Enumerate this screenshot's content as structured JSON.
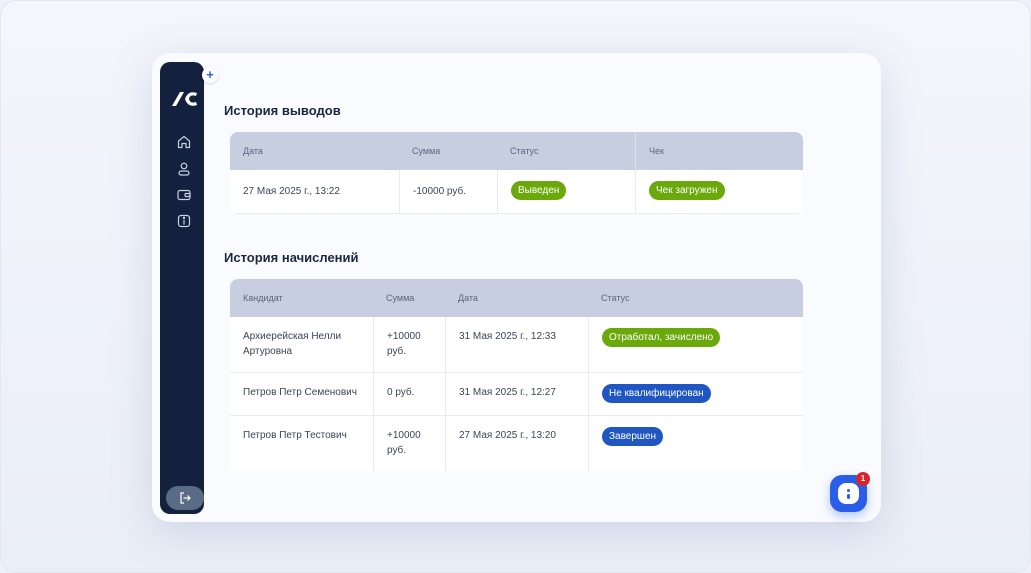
{
  "app": {
    "logo_text": "IC"
  },
  "sidebar": {
    "expand_label": "+",
    "items": [
      {
        "icon": "home-icon"
      },
      {
        "icon": "user-icon"
      },
      {
        "icon": "wallet-icon"
      },
      {
        "icon": "info-icon"
      }
    ],
    "logout_icon": "logout-icon"
  },
  "withdrawals": {
    "title": "История выводов",
    "columns": [
      "Дата",
      "Сумма",
      "Статус",
      "Чек"
    ],
    "rows": [
      {
        "date": "27 Мая 2025 г., 13:22",
        "amount": "-10000 руб.",
        "status": "Выведен",
        "receipt": "Чек загружен"
      }
    ]
  },
  "accruals": {
    "title": "История начислений",
    "columns": [
      "Кандидат",
      "Сумма",
      "Дата",
      "Статус"
    ],
    "rows": [
      {
        "candidate": "Архиерейская Нелли Артуровна",
        "amount": "+10000 руб.",
        "date": "31 Мая 2025 г., 12:33",
        "status": "Отработал, зачислено"
      },
      {
        "candidate": "Петров Петр Семенович",
        "amount": "0 руб.",
        "date": "31 Мая 2025 г., 12:27",
        "status": "Не квалифицирован"
      },
      {
        "candidate": "Петров Петр Тестович",
        "amount": "+10000 руб.",
        "date": "27 Мая 2025 г., 13:20",
        "status": "Завершен"
      }
    ]
  },
  "chat": {
    "unread_count": "1"
  },
  "colors": {
    "sidebar": "#13213e",
    "header_bg": "#c7cedf",
    "badge_green": "#6aa80c",
    "badge_blue": "#1f56c2",
    "chat_blue": "#2a5ee8",
    "notify_red": "#d9242a"
  }
}
